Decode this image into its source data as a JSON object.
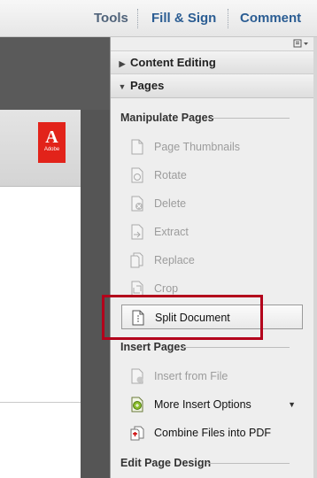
{
  "toolbar": {
    "tools_label": "Tools",
    "fill_sign_label": "Fill & Sign",
    "comment_label": "Comment"
  },
  "document": {
    "logo_letter": "A",
    "logo_text": "Adobe"
  },
  "panel": {
    "sections": {
      "content_editing": "Content Editing",
      "pages": "Pages"
    },
    "groups": {
      "manipulate": "Manipulate Pages",
      "insert": "Insert Pages",
      "edit_design": "Edit Page Design"
    },
    "manipulate_items": [
      {
        "label": "Page Thumbnails",
        "icon": "page-thumbnails-icon",
        "enabled": false
      },
      {
        "label": "Rotate",
        "icon": "rotate-icon",
        "enabled": false
      },
      {
        "label": "Delete",
        "icon": "delete-icon",
        "enabled": false
      },
      {
        "label": "Extract",
        "icon": "extract-icon",
        "enabled": false
      },
      {
        "label": "Replace",
        "icon": "replace-icon",
        "enabled": false
      },
      {
        "label": "Crop",
        "icon": "crop-icon",
        "enabled": false
      },
      {
        "label": "Split Document",
        "icon": "split-document-icon",
        "enabled": true
      }
    ],
    "insert_items": [
      {
        "label": "Insert from File",
        "icon": "insert-from-file-icon",
        "enabled": false
      },
      {
        "label": "More Insert Options",
        "icon": "more-insert-options-icon",
        "enabled": true
      },
      {
        "label": "Combine Files into PDF",
        "icon": "combine-files-icon",
        "enabled": true
      }
    ]
  },
  "colors": {
    "accent_link": "#2b5d93",
    "highlight_box": "#b3001b",
    "adobe_red": "#e2231a"
  }
}
